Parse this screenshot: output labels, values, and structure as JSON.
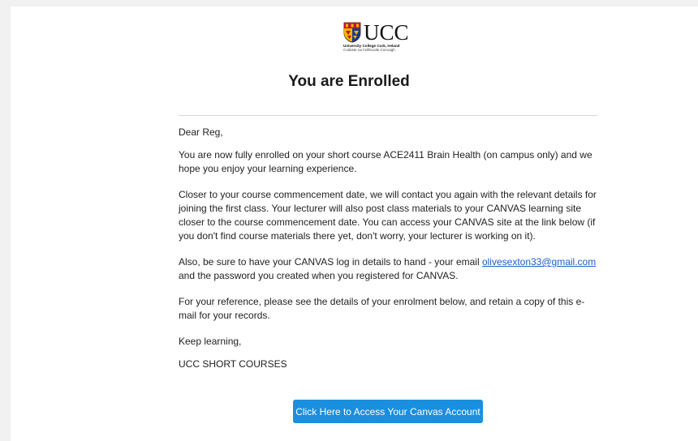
{
  "logo": {
    "wordmark": "UCC",
    "line1": "University College Cork, Ireland",
    "line2": "Coláiste na hOllscoile Corcaigh",
    "colors": {
      "red": "#c8102e",
      "gold": "#f2b705",
      "blue": "#1b3a8f",
      "black": "#111111"
    }
  },
  "email": {
    "title": "You are Enrolled",
    "greeting": "Dear Reg,",
    "para1": "You are now fully enrolled on your short course ACE2411 Brain Health (on campus only) and we hope you enjoy your learning experience.",
    "para2": "Closer to your course commencement date, we will contact you again with the relevant details for joining the first class.  Your lecturer will also post class materials to your CANVAS learning site closer to the course commencement date. You can access your CANVAS site at the link below (if you don't find course materials there yet, don't worry, your lecturer is working on it).",
    "para3_before": "Also, be sure to have your CANVAS log in details to hand - your email ",
    "para3_link": "olivesexton33@gmail.com",
    "para3_after": " and the password you created when you registered for CANVAS.",
    "para4": "For your reference, please see the details of your enrolment below, and retain a copy of this e-mail for your records.",
    "signoff": "Keep learning,",
    "signature": "UCC SHORT COURSES",
    "cta_label": "Click Here to Access Your Canvas Account"
  },
  "colors": {
    "button_bg": "#1a8fe0",
    "link": "#1a5fd0",
    "page_bg": "#f1f1f1"
  }
}
